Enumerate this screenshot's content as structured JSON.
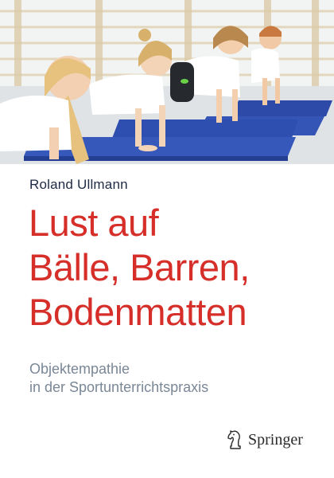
{
  "cover": {
    "author": "Roland Ullmann",
    "title_lines": [
      "Lust auf",
      "Bälle, Barren,",
      "Bodenmatten"
    ],
    "subtitle_lines": [
      "Objektempathie",
      "in der Sportunterrichtspraxis"
    ],
    "publisher": "Springer",
    "publisher_icon": "chess-knight-icon",
    "colors": {
      "title": "#d62e28",
      "author": "#1f2a44",
      "subtitle": "#7a8796",
      "mat": "#2f4fb0"
    }
  }
}
